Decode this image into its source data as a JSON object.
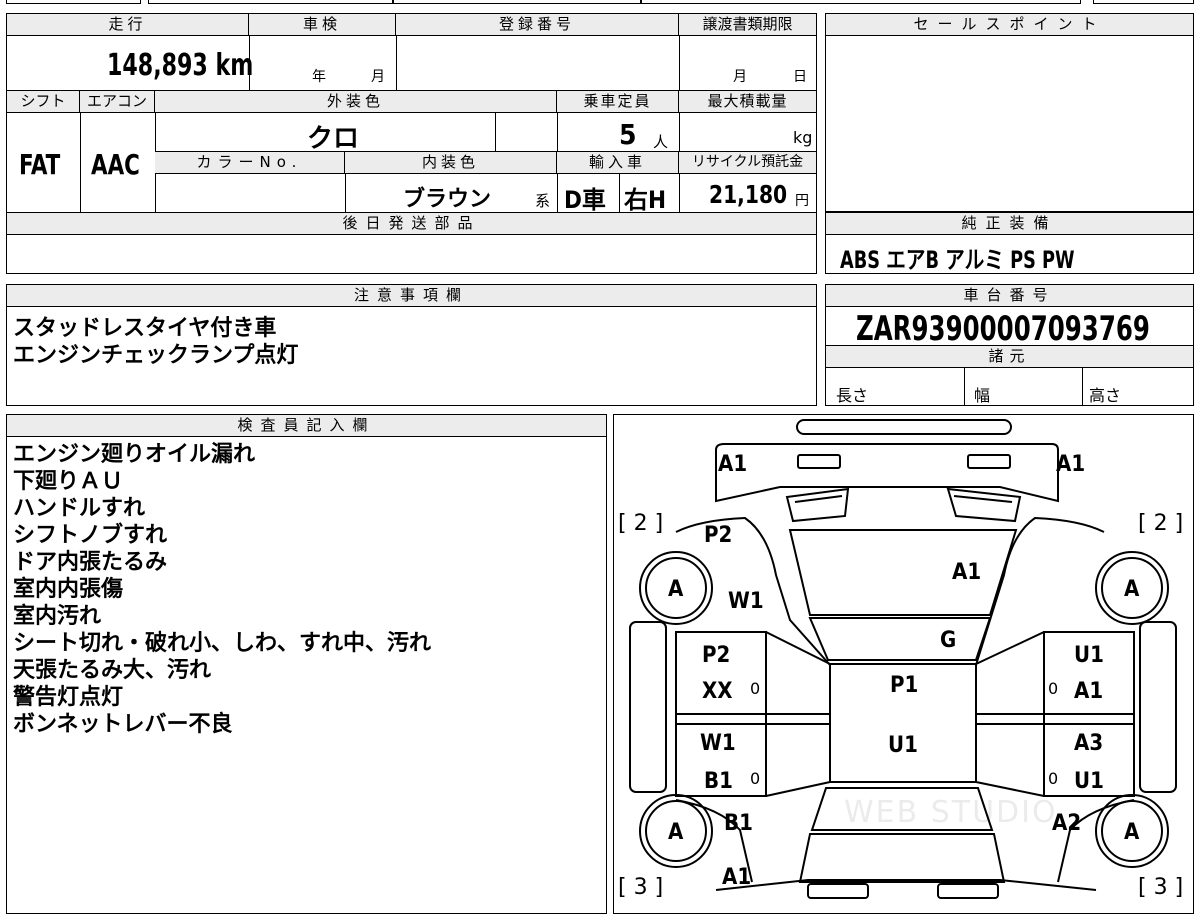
{
  "top": {
    "mileage_label": "走行",
    "mileage_value": "148,893 km",
    "inspection_label": "車検",
    "inspection_year": "年",
    "inspection_month": "月",
    "registration_label": "登録番号",
    "transfer_label": "譲渡書類期限",
    "transfer_month": "月",
    "transfer_day": "日",
    "shift_label": "シフト",
    "shift_value": "FAT",
    "aircon_label": "エアコン",
    "aircon_value": "AAC",
    "exterior_label": "外装色",
    "exterior_value": "クロ",
    "capacity_label": "乗車定員",
    "capacity_value": "5",
    "capacity_unit": "人",
    "maxload_label": "最大積載量",
    "maxload_unit": "kg",
    "colorno_label": "カラーNo.",
    "interior_label": "内装色",
    "interior_value": "ブラウン",
    "interior_suffix": "系",
    "import_label": "輸入車",
    "import_value": "D車",
    "steering_value": "右H",
    "recycle_label": "リサイクル預託金",
    "recycle_value": "21,180",
    "recycle_unit": "円",
    "later_parts_label": "後日発送部品"
  },
  "sales_point": {
    "label": "セールスポイント"
  },
  "equipment": {
    "label": "純正装備",
    "value": "ABS エアB アルミ PS PW"
  },
  "notes": {
    "label": "注意事項欄",
    "lines": [
      "スタッドレスタイヤ付き車",
      "エンジンチェックランプ点灯"
    ]
  },
  "chassis": {
    "label": "車台番号",
    "value": "ZAR93900007093769"
  },
  "specs": {
    "label": "諸元",
    "length": "長さ",
    "width": "幅",
    "height": "高さ"
  },
  "inspector": {
    "label": "検査員記入欄",
    "lines": [
      "エンジン廻りオイル漏れ",
      "下廻りＡＵ",
      "ハンドルすれ",
      "シフトノブすれ",
      "ドア内張たるみ",
      "室内内張傷",
      "室内汚れ",
      "シート切れ・破れ小、しわ、すれ中、汚れ",
      "天張たるみ大、汚れ",
      "警告灯点灯",
      "ボンネットレバー不良"
    ]
  },
  "diagram": {
    "marks": {
      "a1_front_left": "A1",
      "a1_front_right": "A1",
      "bracket_tl": "[ 2 ]",
      "bracket_tr": "[ 2 ]",
      "bracket_bl": "[ 3 ]",
      "bracket_br": "[ 3 ]",
      "p2_fender_left": "P2",
      "w1_fender_left": "W1",
      "a1_hood": "A1",
      "tire_fl": "A",
      "tire_fr": "A",
      "tire_rl": "A",
      "tire_rr": "A",
      "g_windshield": "G",
      "p2_door_fl": "P2",
      "xx_door_fl": "XX",
      "zero_fl": "0",
      "w1_door_rl": "W1",
      "b1_door_rl": "B1",
      "zero_rl": "0",
      "u1_door_fr": "U1",
      "a1_door_fr": "A1",
      "zero_fr": "0",
      "a3_door_rr": "A3",
      "u1_door_rr": "U1",
      "zero_rr": "0",
      "p1_roof": "P1",
      "u1_roof": "U1",
      "b1_rear_left": "B1",
      "a1_rear_left": "A1",
      "a2_rear_right": "A2"
    },
    "watermark": "WEB STUDIO"
  }
}
